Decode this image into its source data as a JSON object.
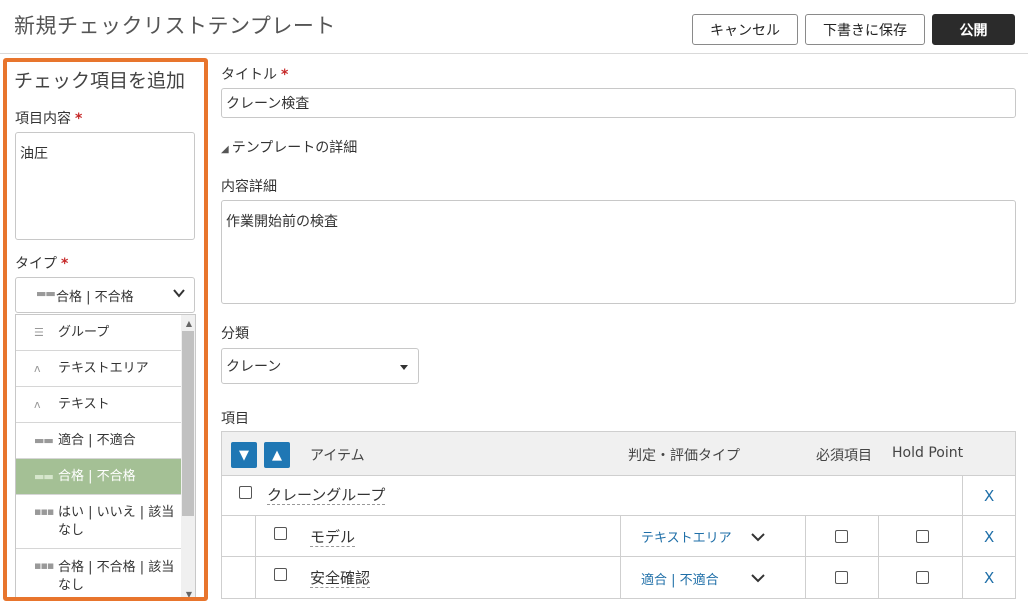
{
  "header": {
    "title": "新規チェックリストテンプレート",
    "cancel_label": "キャンセル",
    "draft_label": "下書きに保存",
    "publish_label": "公開"
  },
  "add_panel": {
    "title": "チェック項目を追加",
    "content_label": "項目内容",
    "content_value": "油圧",
    "type_label": "タイプ",
    "type_selected": "合格 | 不合格",
    "type_options": [
      {
        "label": "グループ",
        "icon": "group-icon"
      },
      {
        "label": "テキストエリア",
        "icon": "text-area-icon"
      },
      {
        "label": "テキスト",
        "icon": "text-icon"
      },
      {
        "label": "適合 | 不適合",
        "icon": "two-option-icon"
      },
      {
        "label": "合格 | 不合格",
        "icon": "two-option-icon",
        "selected": true
      },
      {
        "label": "はい | いいえ | 該当なし",
        "icon": "three-option-icon"
      },
      {
        "label": "合格 | 不合格 | 該当なし",
        "icon": "three-option-icon"
      }
    ]
  },
  "form": {
    "title_label": "タイトル",
    "title_value": "クレーン検査",
    "details_toggle": "テンプレートの詳細",
    "description_label": "内容詳細",
    "description_value": "作業開始前の検査",
    "category_label": "分類",
    "category_value": "クレーン",
    "items_label": "項目"
  },
  "table": {
    "headers": {
      "item": "アイテム",
      "type": "判定・評価タイプ",
      "required": "必須項目",
      "hold_point": "Hold Point"
    },
    "group": {
      "name": "クレーングループ",
      "delete": "X"
    },
    "rows": [
      {
        "name": "モデル",
        "type": "テキストエリア",
        "delete": "X"
      },
      {
        "name": "安全確認",
        "type": "適合 | 不適合",
        "delete": "X"
      }
    ]
  },
  "colors": {
    "accent": "#e8752d",
    "selected_option": "#a4c095",
    "link": "#1f6fa8",
    "sort_button": "#1f77b4",
    "publish_button": "#2b2b2b"
  }
}
